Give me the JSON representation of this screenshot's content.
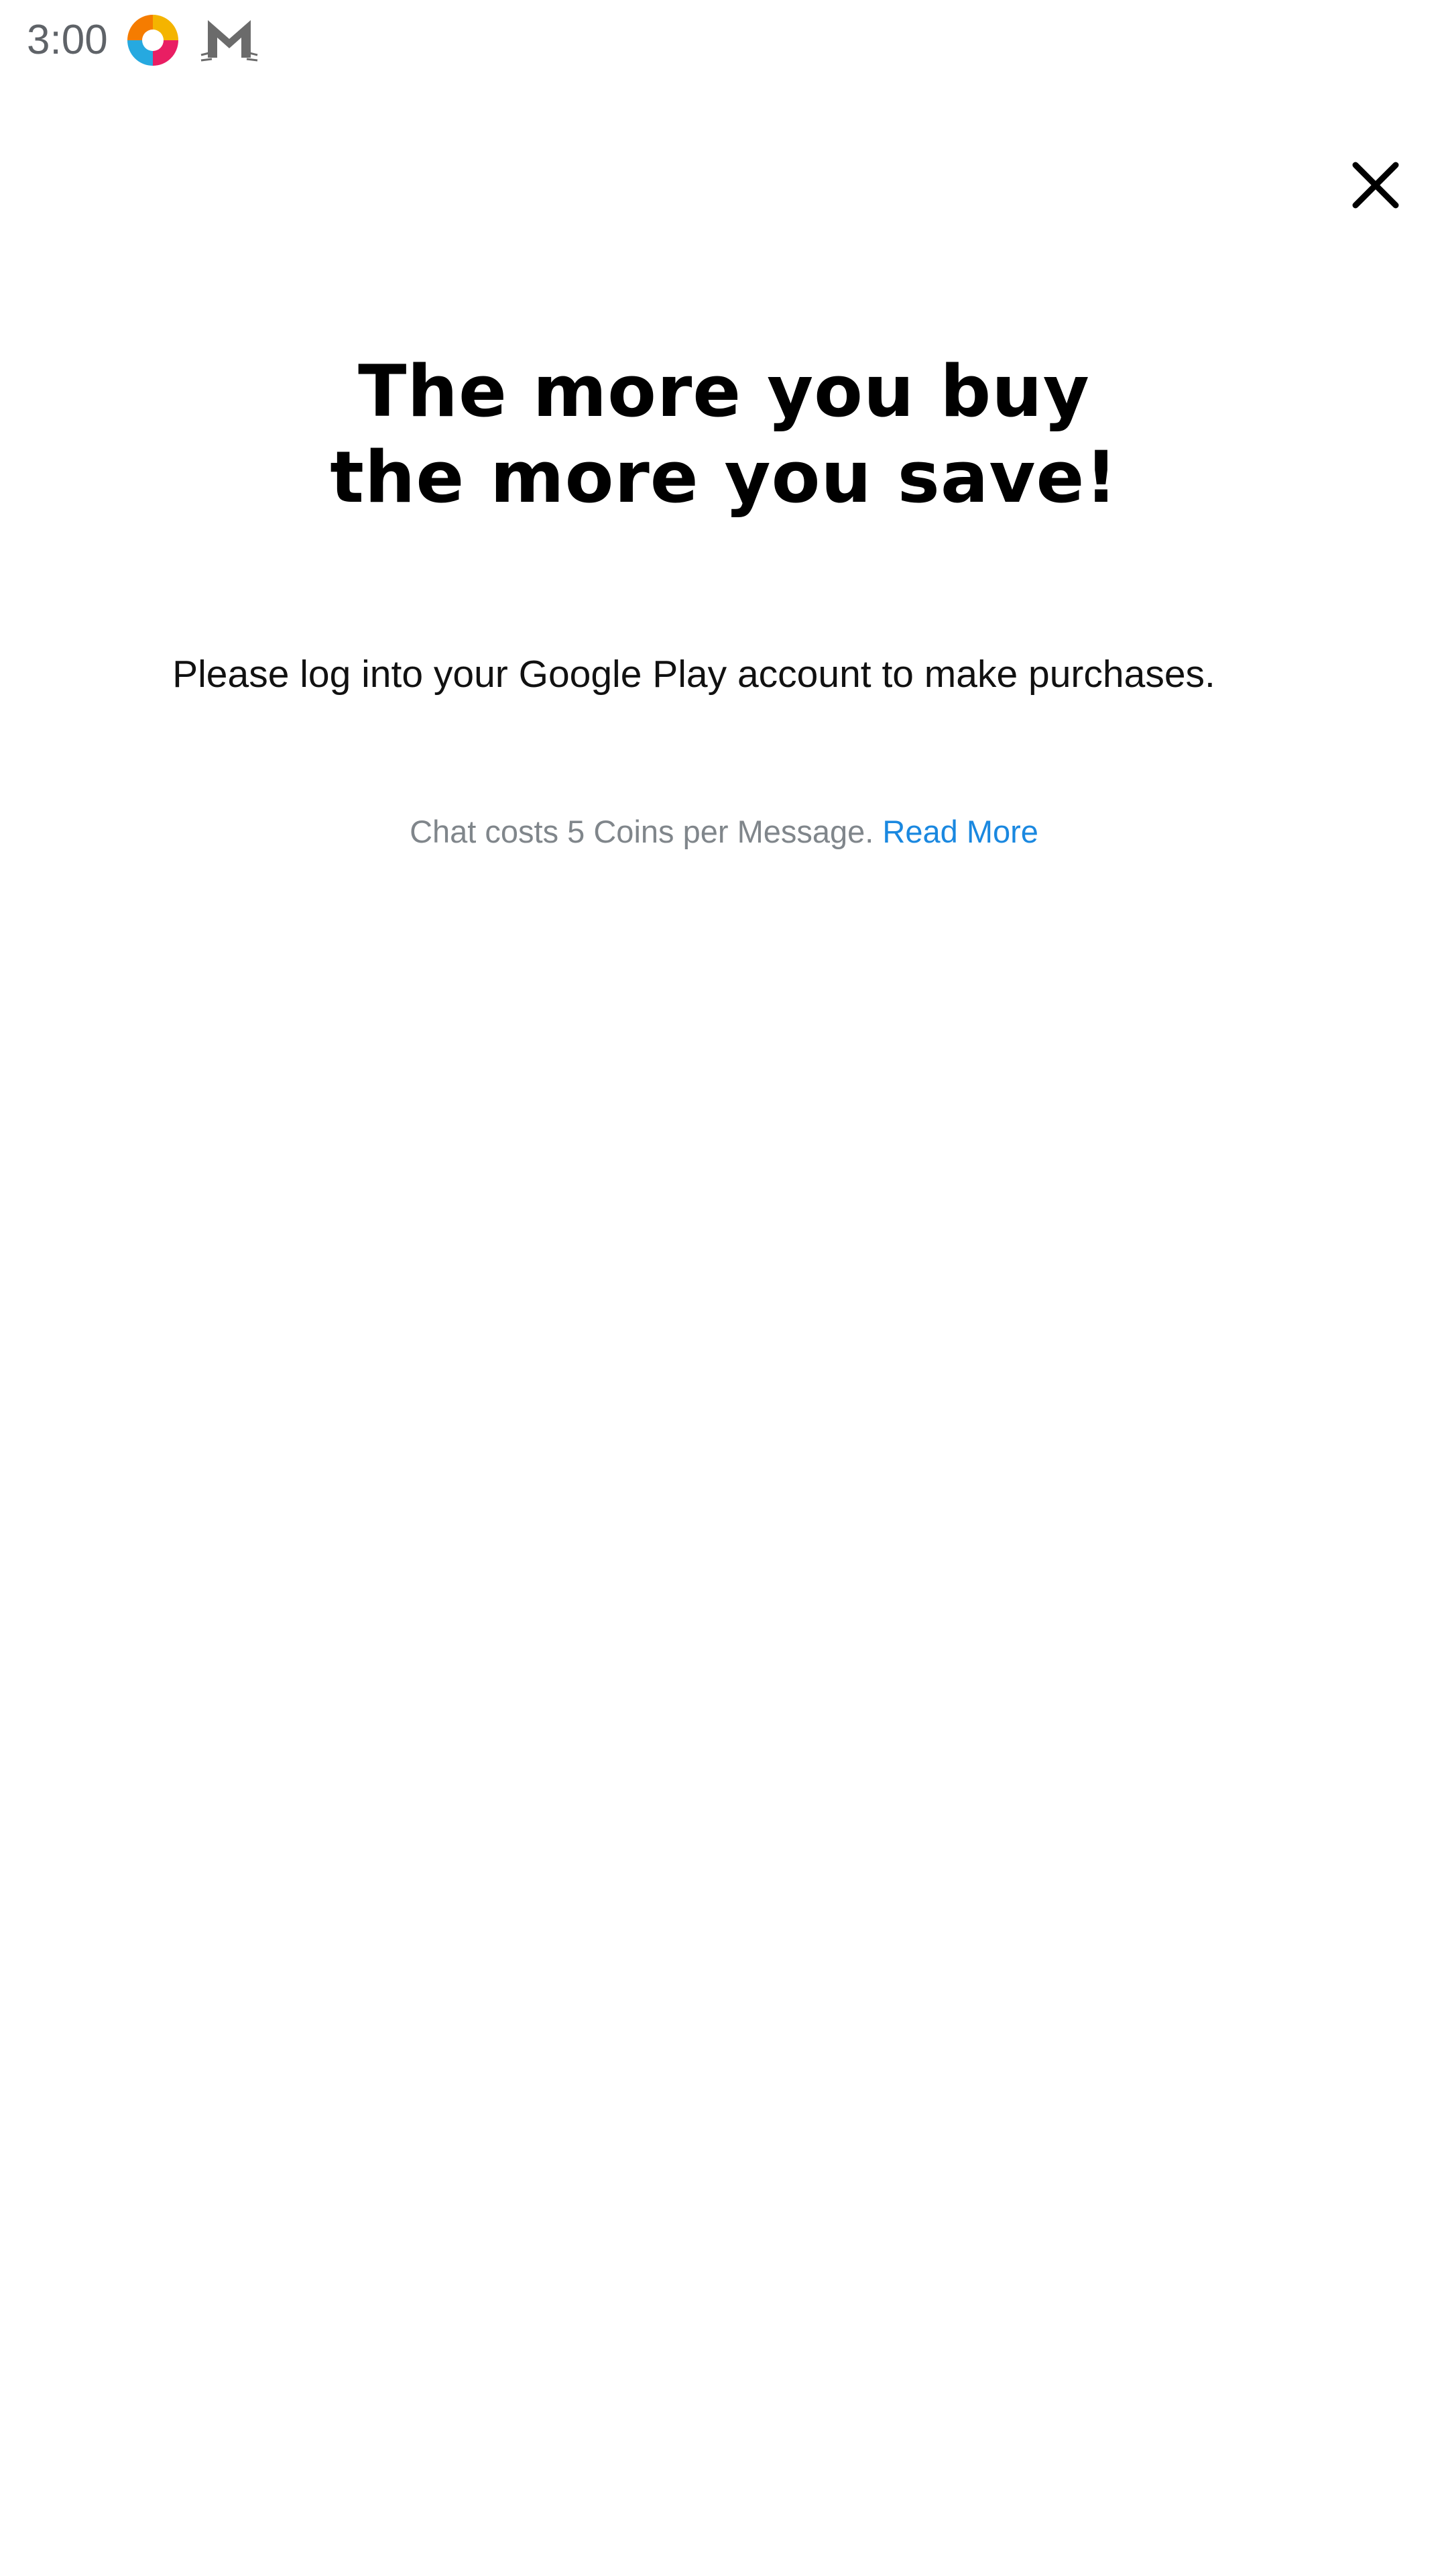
{
  "status_bar": {
    "time": "3:00",
    "icons": [
      "app-icon",
      "mail-icon"
    ]
  },
  "dialog": {
    "close_icon": "close-icon",
    "headline_line1": "The more you buy",
    "headline_line2": "the more you save!",
    "login_message": "Please log into your Google Play account to make purchases.",
    "footnote_text": "Chat costs 5 Coins per Message.",
    "read_more_label": "Read More"
  },
  "colors": {
    "background": "#ffffff",
    "headline": "#000000",
    "footnote": "#80868b",
    "link": "#1a88e0"
  }
}
